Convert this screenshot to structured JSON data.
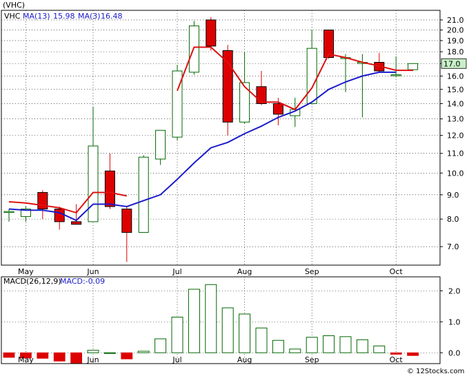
{
  "title": "(VHC)",
  "legend": {
    "symbol": "VHC",
    "ma13_label": "MA(13)",
    "ma13_value": "15.98",
    "ma3_label": "MA(3)",
    "ma3_value": "16.48",
    "macd_params": "MACD(26,12,9)",
    "macd_value_text": "MACD:-0.09"
  },
  "price_badge": "17.0",
  "copyright": "© 12Stocks.com",
  "colors": {
    "up_candle": "#006600",
    "down_candle": "#dd0000",
    "ma13": "#1a1acc",
    "ma3": "#dd1111",
    "macd_bar": "#006600",
    "grid": "#000000",
    "badge_fill": "#c8f0c8"
  },
  "chart_data": [
    {
      "type": "candlestick",
      "ylim": [
        6.4,
        22.0
      ],
      "y_scale": "log",
      "grid": true,
      "y_ticks": [
        "7.0",
        "8.0",
        "9.0",
        "10.0",
        "11.0",
        "12.0",
        "13.0",
        "14.0",
        "15.0",
        "16.0",
        "17.0",
        "18.0",
        "19.0",
        "20.0",
        "21.0"
      ],
      "y_tick_values": [
        7,
        8,
        9,
        10,
        11,
        12,
        13,
        14,
        15,
        16,
        17,
        18,
        19,
        20,
        21
      ],
      "x_labels": [
        "May",
        "Jun",
        "Jul",
        "Aug",
        "Sep",
        "Oct"
      ],
      "x_label_index": [
        1,
        5,
        10,
        14,
        18,
        23
      ],
      "candles": [
        {
          "o": 8.3,
          "c": 8.3,
          "h": 8.4,
          "l": 7.9
        },
        {
          "o": 8.1,
          "c": 8.4,
          "h": 8.5,
          "l": 7.9
        },
        {
          "o": 9.1,
          "c": 8.4,
          "h": 9.2,
          "l": 8.0
        },
        {
          "o": 8.4,
          "c": 7.9,
          "h": 8.5,
          "l": 7.6
        },
        {
          "o": 7.9,
          "c": 7.8,
          "h": 8.6,
          "l": 7.8
        },
        {
          "o": 7.9,
          "c": 11.4,
          "h": 13.8,
          "l": 7.9
        },
        {
          "o": 10.1,
          "c": 8.5,
          "h": 11.0,
          "l": 8.4
        },
        {
          "o": 8.4,
          "c": 7.5,
          "h": 8.5,
          "l": 6.5
        },
        {
          "o": 7.5,
          "c": 10.8,
          "h": 10.9,
          "l": 7.5
        },
        {
          "o": 10.7,
          "c": 12.3,
          "h": 12.3,
          "l": 10.4
        },
        {
          "o": 11.9,
          "c": 16.4,
          "h": 16.9,
          "l": 11.7
        },
        {
          "o": 16.3,
          "c": 20.4,
          "h": 20.9,
          "l": 16.1
        },
        {
          "o": 21.0,
          "c": 18.5,
          "h": 21.3,
          "l": 18.1
        },
        {
          "o": 18.1,
          "c": 12.8,
          "h": 18.6,
          "l": 12.0
        },
        {
          "o": 12.8,
          "c": 15.5,
          "h": 18.0,
          "l": 12.7
        },
        {
          "o": 15.2,
          "c": 14.0,
          "h": 16.4,
          "l": 13.9
        },
        {
          "o": 14.0,
          "c": 13.3,
          "h": 14.4,
          "l": 12.6
        },
        {
          "o": 13.2,
          "c": 13.6,
          "h": 14.4,
          "l": 12.5
        },
        {
          "o": 14.0,
          "c": 18.3,
          "h": 20.0,
          "l": 14.0
        },
        {
          "o": 20.0,
          "c": 17.5,
          "h": 20.0,
          "l": 17.4
        },
        {
          "o": 17.5,
          "c": 17.5,
          "h": 17.8,
          "l": 14.8
        },
        {
          "o": 17.0,
          "c": 17.1,
          "h": 17.8,
          "l": 13.1
        },
        {
          "o": 17.1,
          "c": 16.4,
          "h": 17.9,
          "l": 16.3
        },
        {
          "o": 16.1,
          "c": 16.1,
          "h": 17.6,
          "l": 15.9
        },
        {
          "o": 16.5,
          "c": 17.0,
          "h": 17.0,
          "l": 16.4
        }
      ],
      "series": [
        {
          "name": "MA(13)",
          "values": [
            8.4,
            8.35,
            8.35,
            8.25,
            7.95,
            8.6,
            8.6,
            8.5,
            8.75,
            9.0,
            9.7,
            10.5,
            11.3,
            11.6,
            12.1,
            12.55,
            13.1,
            13.5,
            14.1,
            15.0,
            15.55,
            16.0,
            16.3,
            16.3,
            null
          ]
        },
        {
          "name": "MA(3)",
          "values": [
            8.7,
            8.65,
            8.55,
            8.45,
            8.25,
            9.1,
            9.1,
            8.95,
            null,
            null,
            14.9,
            18.4,
            18.4,
            17.1,
            15.2,
            14.1,
            14.1,
            13.6,
            15.1,
            17.8,
            17.5,
            17.1,
            16.8,
            16.45,
            16.45
          ]
        }
      ]
    },
    {
      "type": "bar",
      "ylim": [
        -0.35,
        2.45
      ],
      "grid": true,
      "y_ticks": [
        "0.0",
        "1.0",
        "2.0"
      ],
      "y_tick_values": [
        0,
        1,
        2
      ],
      "x_labels": [
        "May",
        "Jun",
        "Jul",
        "Aug",
        "Sep",
        "Oct"
      ],
      "values": [
        -0.15,
        -0.17,
        -0.18,
        -0.27,
        -0.34,
        0.08,
        0.0,
        -0.2,
        0.05,
        0.45,
        1.15,
        2.05,
        2.2,
        1.45,
        1.25,
        0.8,
        0.4,
        0.12,
        0.5,
        0.55,
        0.52,
        0.42,
        0.22,
        -0.05,
        -0.09
      ]
    }
  ]
}
